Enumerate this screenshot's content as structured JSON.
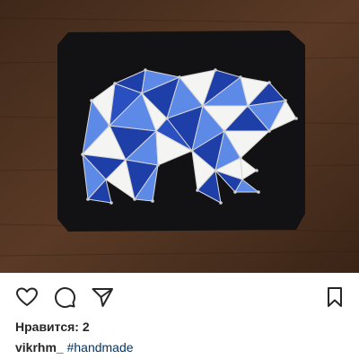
{
  "post": {
    "photo": {
      "subject": "geometric string art bear on black board",
      "colors": {
        "wood": "#4a2f1f",
        "board": "#121214",
        "blue_dark": "#1f3fa8",
        "blue_light": "#5d8ae6",
        "white": "#f4f4f2",
        "nail": "#c9c9c9"
      }
    },
    "actions": {
      "like_icon": "heart-icon",
      "comment_icon": "comment-icon",
      "share_icon": "paper-plane-icon",
      "save_icon": "bookmark-icon"
    },
    "likes_text": "Нравится: 2",
    "caption": {
      "username": "vikrhm_",
      "hashtag": "#handmade"
    }
  }
}
